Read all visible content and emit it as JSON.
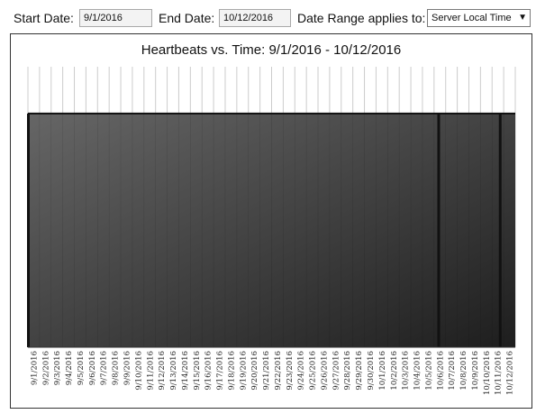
{
  "controls": {
    "start_label": "Start Date:",
    "start_value": "9/1/2016",
    "end_label": "End Date:",
    "end_value": "10/12/2016",
    "range_label": "Date Range applies to:",
    "range_selected": "Server Local Time"
  },
  "chart_data": {
    "type": "bar",
    "title": "Heartbeats vs. Time: 9/1/2016 - 10/12/2016",
    "xlabel": "",
    "ylabel": "",
    "categories": [
      "9/1/2016",
      "9/2/2016",
      "9/3/2016",
      "9/4/2016",
      "9/5/2016",
      "9/6/2016",
      "9/7/2016",
      "9/8/2016",
      "9/9/2016",
      "9/10/2016",
      "9/11/2016",
      "9/12/2016",
      "9/13/2016",
      "9/14/2016",
      "9/15/2016",
      "9/16/2016",
      "9/17/2016",
      "9/18/2016",
      "9/19/2016",
      "9/20/2016",
      "9/21/2016",
      "9/22/2016",
      "9/23/2016",
      "9/24/2016",
      "9/25/2016",
      "9/26/2016",
      "9/27/2016",
      "9/28/2016",
      "9/29/2016",
      "9/30/2016",
      "10/1/2016",
      "10/2/2016",
      "10/3/2016",
      "10/4/2016",
      "10/5/2016",
      "10/6/2016",
      "10/7/2016",
      "10/8/2016",
      "10/9/2016",
      "10/10/2016",
      "10/11/2016",
      "10/12/2016"
    ],
    "values": [
      1,
      1,
      1,
      1,
      1,
      1,
      1,
      1,
      1,
      1,
      1,
      1,
      1,
      1,
      1,
      1,
      1,
      1,
      1,
      1,
      1,
      1,
      1,
      1,
      1,
      1,
      1,
      1,
      1,
      1,
      1,
      1,
      1,
      1,
      1,
      1,
      1,
      1,
      1,
      1,
      1,
      1
    ],
    "ylim": [
      0,
      1.2
    ],
    "grid": true,
    "legend": "none",
    "colors": {
      "bar_light": "#666666",
      "bar_dark": "#1e1e1e",
      "grid": "#cccccc"
    }
  }
}
